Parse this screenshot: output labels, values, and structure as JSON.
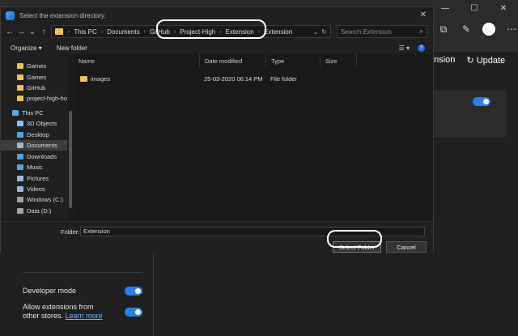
{
  "dialog": {
    "title": "Select the extension directory.",
    "close_glyph": "✕",
    "nav": {
      "back": "←",
      "forward": "→",
      "history": "⌄",
      "up": "↑"
    },
    "breadcrumb": [
      "This PC",
      "Documents",
      "GitHub",
      "Project-High",
      "Extension",
      "Extension"
    ],
    "address_dropdown": "⌄",
    "refresh": "↻",
    "search_placeholder": "Search Extension",
    "organize_label": "Organize ▾",
    "new_folder_label": "New folder",
    "help": "?",
    "nav_items": [
      {
        "label": "Games",
        "icon": "folder-icon",
        "color": "#f2c14e"
      },
      {
        "label": "Games",
        "icon": "folder-icon",
        "color": "#f2c14e"
      },
      {
        "label": "GitHub",
        "icon": "folder-icon",
        "color": "#f2c14e"
      },
      {
        "label": "project-high-ho",
        "icon": "folder-icon",
        "color": "#f2c14e"
      },
      {
        "label": "This PC",
        "icon": "computer-icon",
        "color": "#5aa8e6"
      },
      {
        "label": "3D Objects",
        "icon": "cube-icon",
        "color": "#7ac8ff"
      },
      {
        "label": "Desktop",
        "icon": "desktop-icon",
        "color": "#4aa3e8"
      },
      {
        "label": "Documents",
        "icon": "documents-icon",
        "color": "#9fb8cf"
      },
      {
        "label": "Downloads",
        "icon": "download-icon",
        "color": "#4aa3e8"
      },
      {
        "label": "Music",
        "icon": "music-icon",
        "color": "#4aa3e8"
      },
      {
        "label": "Pictures",
        "icon": "pictures-icon",
        "color": "#9fb8cf"
      },
      {
        "label": "Videos",
        "icon": "videos-icon",
        "color": "#9fb8cf"
      },
      {
        "label": "Windows (C:)",
        "icon": "drive-icon",
        "color": "#9aa6b2"
      },
      {
        "label": "Data (D:)",
        "icon": "drive-icon",
        "color": "#9aa6b2"
      }
    ],
    "columns": [
      "Name",
      "Date modified",
      "Type",
      "Size"
    ],
    "rows": [
      {
        "name": "images",
        "date": "25-03-2020 06:14 PM",
        "type": "File folder",
        "size": ""
      }
    ],
    "folder_label": "Folder:",
    "folder_value": "Extension",
    "select_button": "Select Folder",
    "cancel_button": "Cancel"
  },
  "edge": {
    "extension_label": "ension",
    "update_label": "Update",
    "developer_mode": "Developer mode",
    "allow_text": "Allow extensions from other stores.",
    "learn_more": "Learn more",
    "avatar_glyph": "☺",
    "win_controls": [
      "—",
      "☐",
      "✕"
    ]
  },
  "colors": {
    "accent": "#2b7de9",
    "folder": "#f2c14e",
    "highlight_ring": "#ffffff"
  }
}
